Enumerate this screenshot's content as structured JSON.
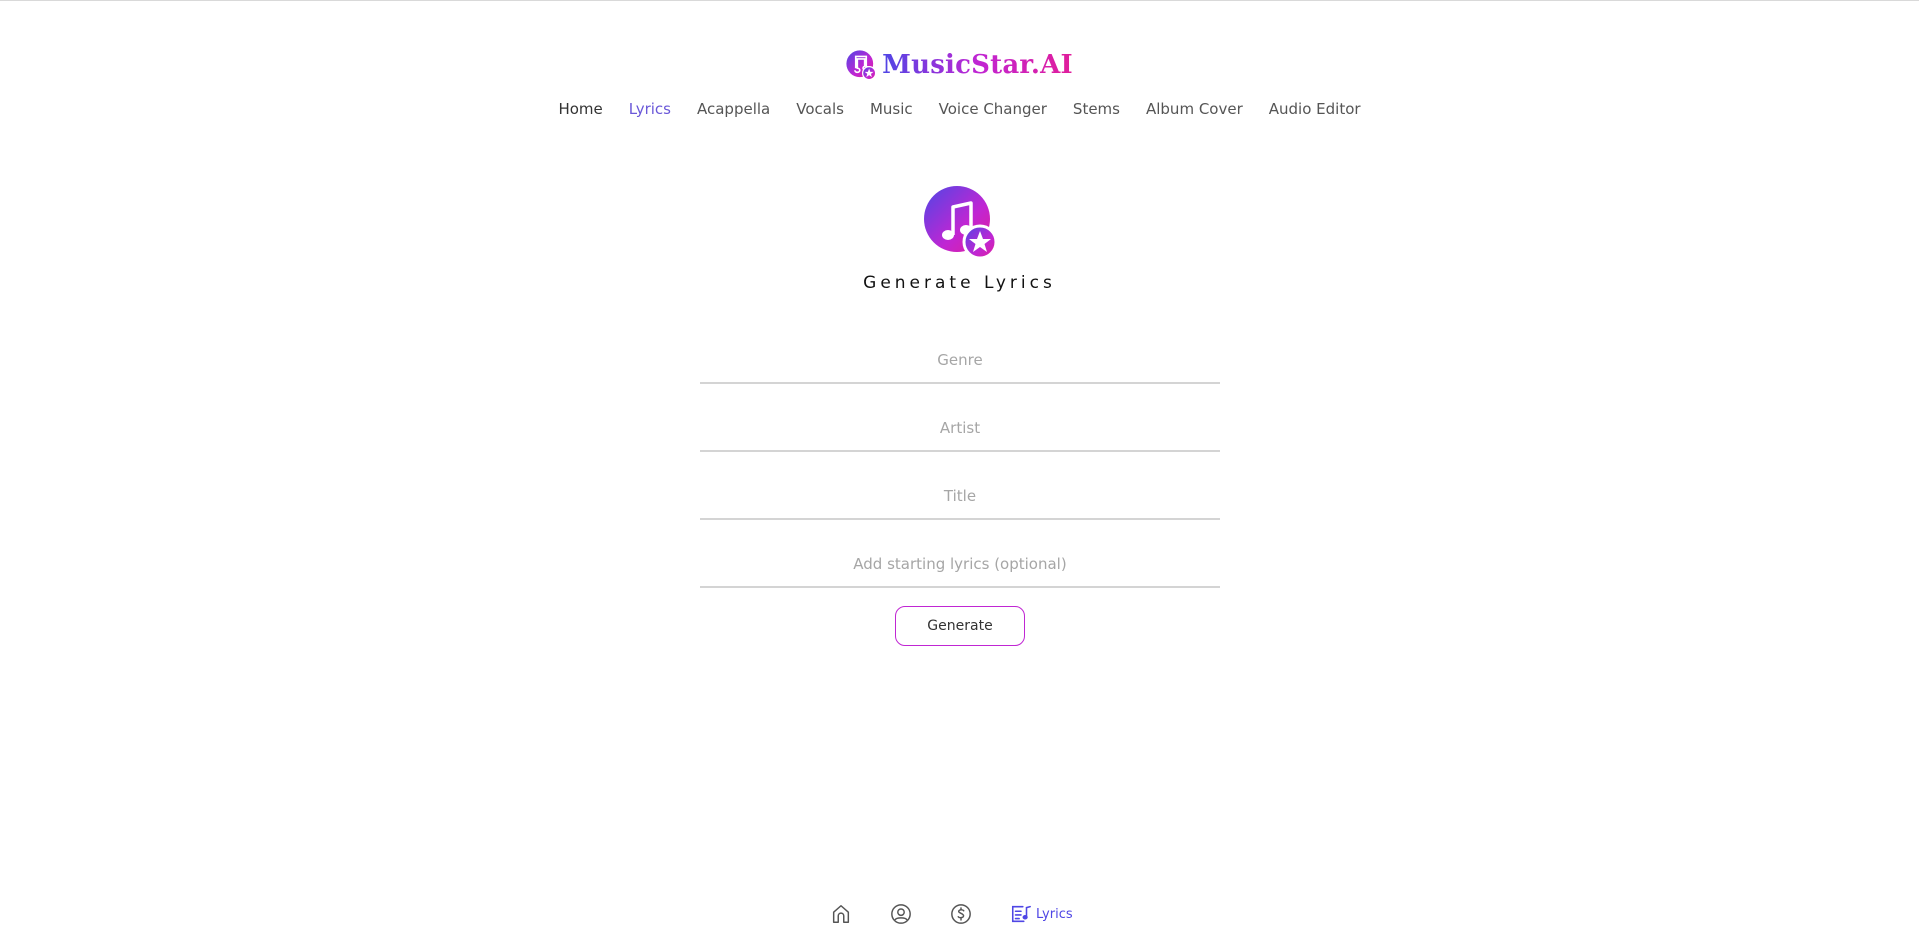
{
  "brand": {
    "name": "MusicStar.AI",
    "logo_icon": "music-star-icon",
    "gradient": [
      "#4f46e5",
      "#c026d3",
      "#e11d9a"
    ]
  },
  "nav": {
    "items": [
      {
        "label": "Home",
        "active": false
      },
      {
        "label": "Lyrics",
        "active": true
      },
      {
        "label": "Acappella",
        "active": false
      },
      {
        "label": "Vocals",
        "active": false
      },
      {
        "label": "Music",
        "active": false
      },
      {
        "label": "Voice Changer",
        "active": false
      },
      {
        "label": "Stems",
        "active": false
      },
      {
        "label": "Album Cover",
        "active": false
      },
      {
        "label": "Audio Editor",
        "active": false
      }
    ],
    "active_color": "#6a58d8"
  },
  "hero": {
    "icon": "music-star-icon",
    "title": "Generate Lyrics"
  },
  "form": {
    "genre": {
      "placeholder": "Genre",
      "value": ""
    },
    "artist": {
      "placeholder": "Artist",
      "value": ""
    },
    "title": {
      "placeholder": "Title",
      "value": ""
    },
    "starting_lyrics": {
      "placeholder": "Add starting lyrics (optional)",
      "value": ""
    },
    "generate_label": "Generate"
  },
  "bottom_nav": {
    "items": [
      {
        "icon": "home-icon"
      },
      {
        "icon": "user-circle-icon"
      },
      {
        "icon": "dollar-circle-icon"
      },
      {
        "icon": "lyrics-icon",
        "label": "Lyrics",
        "active": true
      }
    ]
  }
}
